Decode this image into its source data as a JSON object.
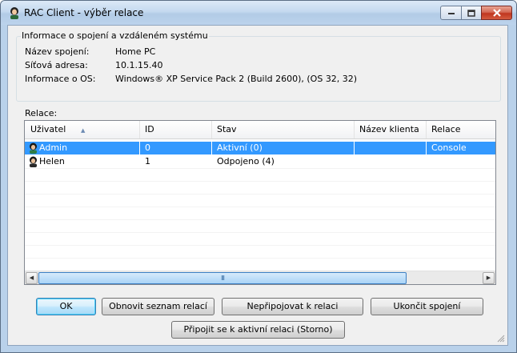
{
  "window": {
    "title": "RAC Client - výběr relace",
    "minimize_icon": "minimize-icon",
    "maximize_icon": "maximize-icon",
    "close_icon": "close-icon"
  },
  "connection_info": {
    "legend": "Informace o spojení a vzdáleném systému",
    "rows": [
      {
        "label": "Název spojení:",
        "value": "Home PC"
      },
      {
        "label": "Síťová adresa:",
        "value": "10.1.15.40"
      },
      {
        "label": "Informace o OS:",
        "value": "Windows® XP Service Pack 2 (Build 2600), (OS 32, 32)"
      }
    ]
  },
  "sessions": {
    "label": "Relace:",
    "columns": [
      "Uživatel",
      "ID",
      "Stav",
      "Název klienta",
      "Relace"
    ],
    "sorted_column": "Uživatel",
    "rows": [
      {
        "user": "Admin",
        "id": "0",
        "state": "Aktivní (0)",
        "client": "",
        "session": "Console",
        "selected": true
      },
      {
        "user": "Helen",
        "id": "1",
        "state": "Odpojeno (4)",
        "client": "",
        "session": "",
        "selected": false
      }
    ],
    "scrollbar": {
      "left_icon": "scroll-left-icon",
      "right_icon": "scroll-right-icon",
      "thumb_grip": "III"
    }
  },
  "buttons": {
    "ok": "OK",
    "refresh": "Obnovit seznam relací",
    "no_connect": "Nepřipojovat k relaci",
    "end": "Ukončit spojení",
    "connect_active": "Připojit se k aktivní relaci (Storno)"
  },
  "colors": {
    "selection": "#3399ff",
    "title_gradient_top": "#dce9f7",
    "close_button": "#c0361f"
  }
}
